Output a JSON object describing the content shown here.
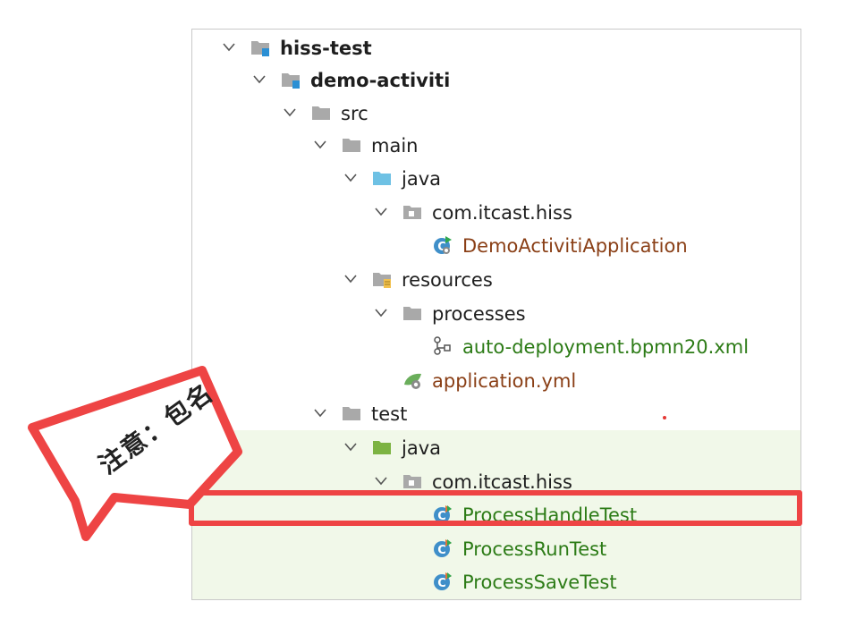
{
  "tree": {
    "items": [
      {
        "label": "hiss-test",
        "depth": 0,
        "icon": "module-folder-icon",
        "expanded": true,
        "bold": true,
        "color": "default"
      },
      {
        "label": "demo-activiti",
        "depth": 1,
        "icon": "module-folder-icon",
        "expanded": true,
        "bold": true,
        "color": "default"
      },
      {
        "label": "src",
        "depth": 2,
        "icon": "folder-icon",
        "expanded": true,
        "bold": false,
        "color": "default"
      },
      {
        "label": "main",
        "depth": 3,
        "icon": "folder-icon",
        "expanded": true,
        "bold": false,
        "color": "default"
      },
      {
        "label": "java",
        "depth": 4,
        "icon": "source-folder-icon",
        "expanded": true,
        "bold": false,
        "color": "default"
      },
      {
        "label": "com.itcast.hiss",
        "depth": 5,
        "icon": "package-icon",
        "expanded": true,
        "bold": false,
        "color": "default"
      },
      {
        "label": "DemoActivitiApplication",
        "depth": 6,
        "icon": "spring-boot-class-icon",
        "expanded": null,
        "bold": false,
        "color": "brown"
      },
      {
        "label": "resources",
        "depth": 4,
        "icon": "resources-folder-icon",
        "expanded": true,
        "bold": false,
        "color": "default"
      },
      {
        "label": "processes",
        "depth": 5,
        "icon": "folder-icon",
        "expanded": true,
        "bold": false,
        "color": "default"
      },
      {
        "label": "auto-deployment.bpmn20.xml",
        "depth": 6,
        "icon": "bpmn-file-icon",
        "expanded": null,
        "bold": false,
        "color": "green"
      },
      {
        "label": "application.yml",
        "depth": 5,
        "icon": "spring-config-icon",
        "expanded": null,
        "bold": false,
        "color": "brown"
      },
      {
        "label": "test",
        "depth": 3,
        "icon": "folder-icon",
        "expanded": true,
        "bold": false,
        "color": "default"
      },
      {
        "label": "java",
        "depth": 4,
        "icon": "test-source-folder-icon",
        "expanded": true,
        "bold": false,
        "color": "default"
      },
      {
        "label": "com.itcast.hiss",
        "depth": 5,
        "icon": "package-icon",
        "expanded": true,
        "bold": false,
        "color": "default"
      },
      {
        "label": "ProcessHandleTest",
        "depth": 6,
        "icon": "test-class-icon",
        "expanded": null,
        "bold": false,
        "color": "green"
      },
      {
        "label": "ProcessRunTest",
        "depth": 6,
        "icon": "test-class-icon",
        "expanded": null,
        "bold": false,
        "color": "green"
      },
      {
        "label": "ProcessSaveTest",
        "depth": 6,
        "icon": "test-class-icon",
        "expanded": null,
        "bold": false,
        "color": "green"
      }
    ]
  },
  "callout": {
    "text": "注意：包名"
  },
  "colors": {
    "highlight": "#ee4444",
    "callout_border": "#ee4444",
    "test_zone_bg": "#f1f8e9",
    "label_brown": "#8a3f16",
    "label_green": "#2c7b16",
    "source_folder_blue": "#6ec1e4",
    "test_folder_green": "#7cb342"
  }
}
